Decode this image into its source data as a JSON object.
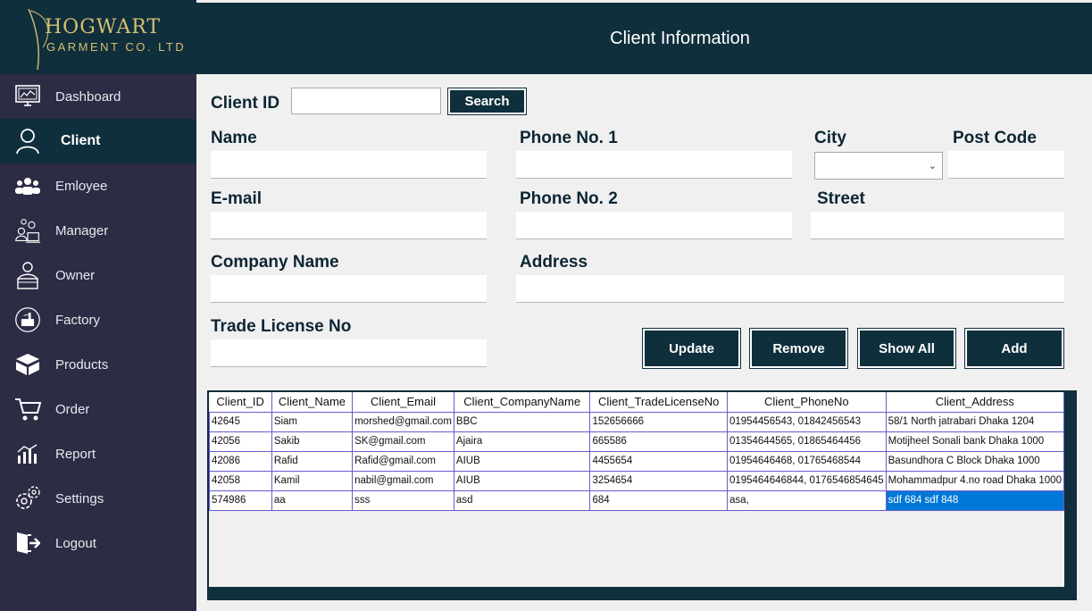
{
  "app": {
    "logo_line1": "HOGWART",
    "logo_line2": "GARMENT CO. LTD"
  },
  "header": {
    "title": "Client Information"
  },
  "sidebar": {
    "items": [
      {
        "label": "Dashboard",
        "icon": "dashboard-icon",
        "active": false
      },
      {
        "label": "Client",
        "icon": "user-icon",
        "active": true
      },
      {
        "label": "Emloyee",
        "icon": "group-icon",
        "active": false
      },
      {
        "label": "Manager",
        "icon": "manager-icon",
        "active": false
      },
      {
        "label": "Owner",
        "icon": "owner-icon",
        "active": false
      },
      {
        "label": "Factory",
        "icon": "factory-icon",
        "active": false
      },
      {
        "label": "Products",
        "icon": "products-icon",
        "active": false
      },
      {
        "label": "Order",
        "icon": "cart-icon",
        "active": false
      },
      {
        "label": "Report",
        "icon": "report-icon",
        "active": false
      },
      {
        "label": "Settings",
        "icon": "gear-icon",
        "active": false
      },
      {
        "label": "Logout",
        "icon": "logout-icon",
        "active": false
      }
    ]
  },
  "form": {
    "client_id_label": "Client ID",
    "client_id_value": "",
    "search_label": "Search",
    "name_label": "Name",
    "name_value": "",
    "phone1_label": "Phone No. 1",
    "phone1_value": "",
    "city_label": "City",
    "city_value": "",
    "postcode_label": "Post Code",
    "postcode_value": "",
    "email_label": "E-mail",
    "email_value": "",
    "phone2_label": "Phone No. 2",
    "phone2_value": "",
    "street_label": "Street",
    "street_value": "",
    "company_label": "Company Name",
    "company_value": "",
    "address_label": "Address",
    "address_value": "",
    "trade_label": "Trade License No",
    "trade_value": ""
  },
  "buttons": {
    "update": "Update",
    "remove": "Remove",
    "show_all": "Show All",
    "add": "Add"
  },
  "table": {
    "columns": [
      "Client_ID",
      "Client_Name",
      "Client_Email",
      "Client_CompanyName",
      "Client_TradeLicenseNo",
      "Client_PhoneNo",
      "Client_Address"
    ],
    "rows": [
      [
        "42645",
        "Siam",
        "morshed@gmail.com",
        "BBC",
        "152656666",
        "01954456543, 01842456543",
        "58/1 North jatrabari Dhaka 1204"
      ],
      [
        "42056",
        "Sakib",
        "SK@gmail.com",
        "Ajaira",
        "665586",
        "01354644565, 01865464456",
        "Motijheel Sonali bank Dhaka 1000"
      ],
      [
        "42086",
        "Rafid",
        "Rafid@gmail.com",
        "AIUB",
        "4455654",
        "01954646468, 01765468544",
        "Basundhora  C Block Dhaka 1000"
      ],
      [
        "42058",
        "Kamil",
        "nabil@gmail.com",
        "AIUB",
        "3254654",
        "0195464646844, 0176546854645",
        "Mohammadpur 4.no road Dhaka 1000"
      ],
      [
        "574986",
        "aa",
        "sss",
        "asd",
        "684",
        "asa,",
        "sdf 684 sdf 848"
      ]
    ],
    "selected_cell": "sdf 684 sdf 848"
  }
}
